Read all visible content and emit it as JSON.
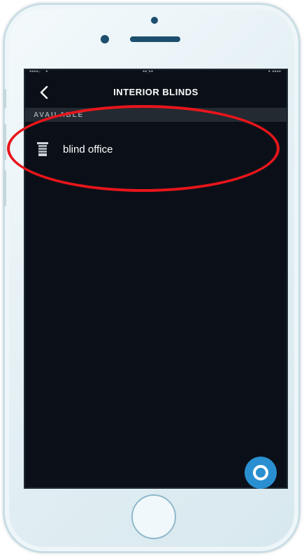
{
  "status_bar": {
    "left": "••••◦   •",
    "time": "••:••",
    "battery": "• ••••"
  },
  "nav": {
    "title": "INTERIOR BLINDS",
    "back_icon": "chevron-left-icon"
  },
  "section": {
    "label": "AVAILABLE"
  },
  "devices": [
    {
      "label": "blind office",
      "icon": "blind-icon"
    }
  ],
  "alexa_button": {
    "icon": "alexa-ring-icon",
    "color": "#2a8fd0"
  },
  "colors": {
    "screen_bg": "#0b1018",
    "section_bg": "#232a31",
    "annotation": "#e8151b"
  }
}
